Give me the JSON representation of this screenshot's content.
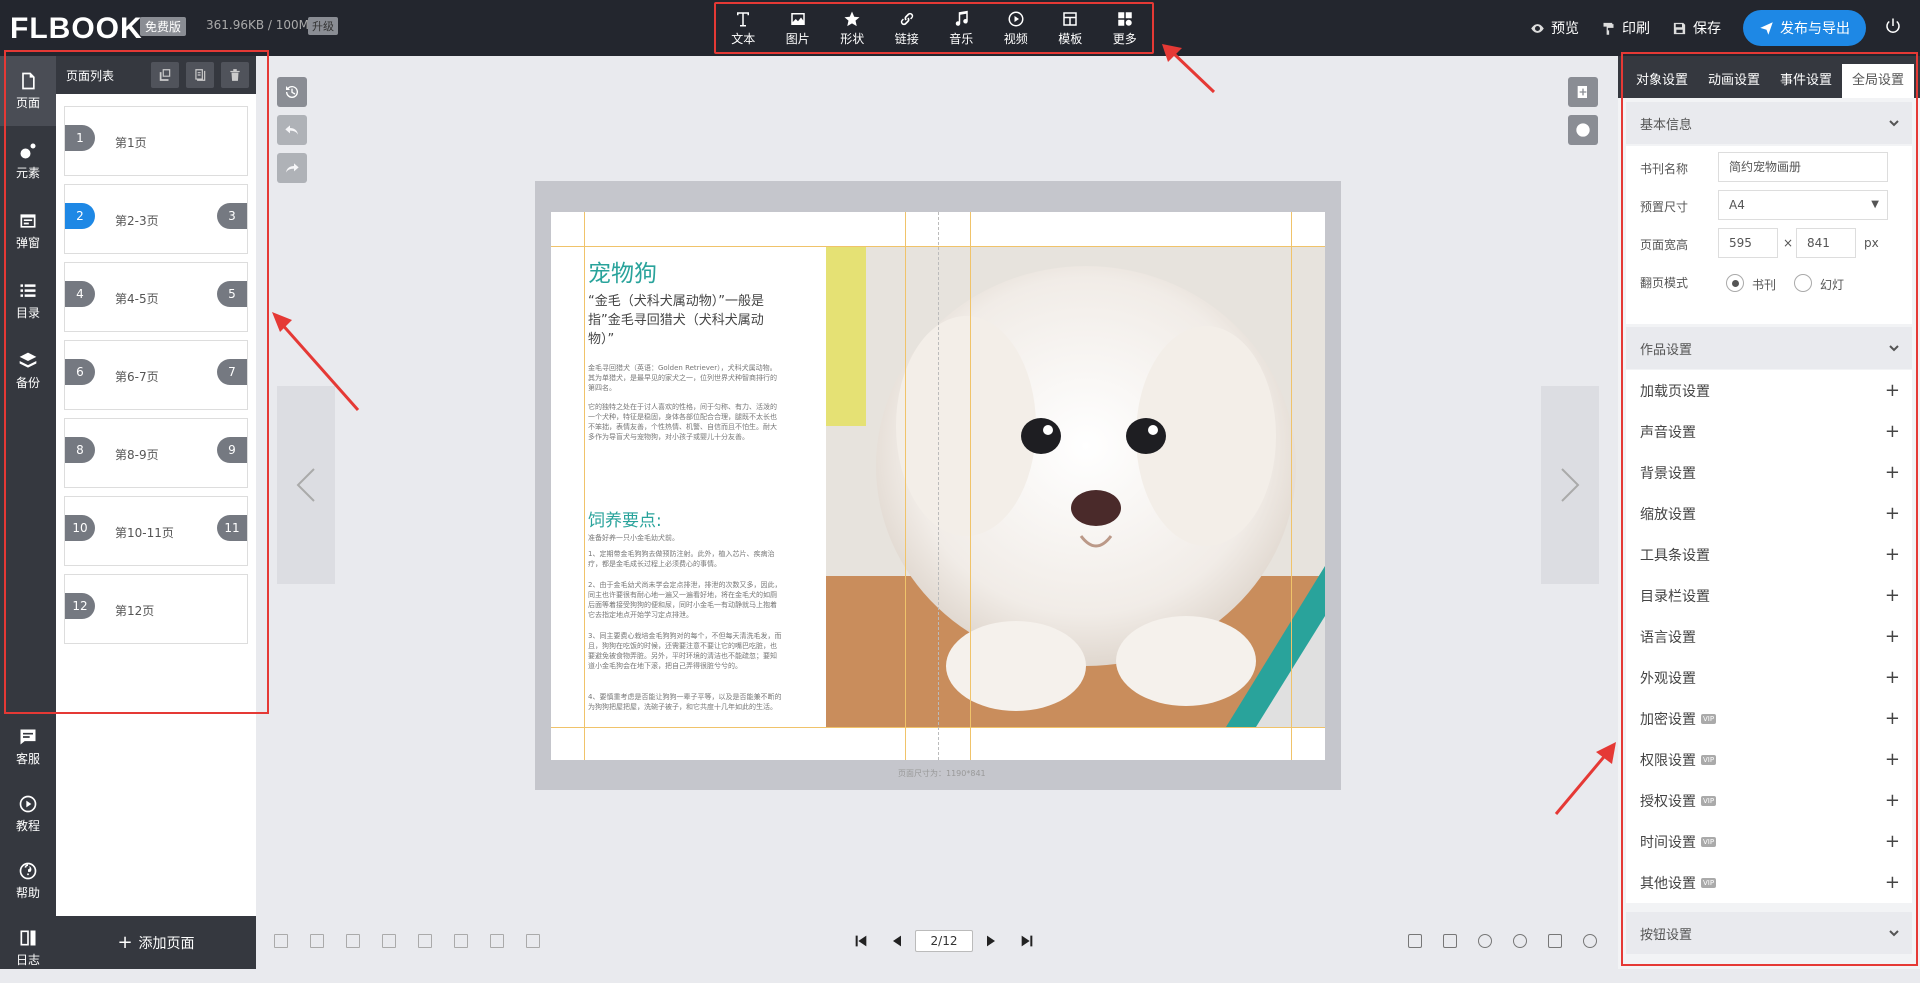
{
  "app": {
    "logo": "FLBOOK",
    "logo_mark": "®",
    "free_badge": "免费版",
    "storage": "361.96KB / 100M",
    "upgrade_badge": "升级"
  },
  "toolbar": {
    "items": [
      {
        "label": "文本",
        "icon": "text-icon"
      },
      {
        "label": "图片",
        "icon": "image-icon"
      },
      {
        "label": "形状",
        "icon": "star-icon"
      },
      {
        "label": "链接",
        "icon": "link-icon"
      },
      {
        "label": "音乐",
        "icon": "music-icon"
      },
      {
        "label": "视频",
        "icon": "video-icon"
      },
      {
        "label": "模板",
        "icon": "template-icon"
      },
      {
        "label": "更多",
        "icon": "more-icon"
      }
    ]
  },
  "topright": {
    "preview": "预览",
    "print": "印刷",
    "save": "保存",
    "publish": "发布与导出"
  },
  "leftnav": {
    "items": [
      "页面",
      "元素",
      "弹窗",
      "目录",
      "备份",
      "客服",
      "教程",
      "帮助",
      "日志"
    ]
  },
  "pagepanel": {
    "title": "页面列表",
    "pages": [
      {
        "label": "第1页",
        "left": "1",
        "right": ""
      },
      {
        "label": "第2-3页",
        "left": "2",
        "right": "3"
      },
      {
        "label": "第4-5页",
        "left": "4",
        "right": "5"
      },
      {
        "label": "第6-7页",
        "left": "6",
        "right": "7"
      },
      {
        "label": "第8-9页",
        "left": "8",
        "right": "9"
      },
      {
        "label": "第10-11页",
        "left": "10",
        "right": "11"
      },
      {
        "label": "第12页",
        "left": "12",
        "right": ""
      }
    ],
    "add_page": "添加页面"
  },
  "book": {
    "title": "宠物狗",
    "subtitle": "“金毛（犬科犬属动物）”一般是指”金毛寻回猎犬（犬科犬属动物）”",
    "para1": "金毛寻回猎犬（英语：Golden Retriever），犬科犬属动物。其为单猎犬，是最早见的家犬之一，位列世界犬种智商排行的第四名。",
    "para2": "它的独特之处在于讨人喜欢的性格，间于匀称、有力、活泼的一个犬种，特征是稳固，身体各部位配合合理，腿既不太长也不笨拙，表情友善，个性热情、机警、自信而且不怕生。耐大多作为导盲犬与宠物狗，对小孩子或婴儿十分友善。",
    "h2": "饲养要点:",
    "para3": "准备好养一只小金毛幼犬前。",
    "para4": "1、定期带金毛狗狗去做预防注射。此外，植入芯片、疾病治疗，都是金毛成长过程上必须费心的事情。",
    "para5": "2、由于金毛幼犬尚未学会定点排泄，排泄的次数又多，因此，同主也许要很有耐心地一遍又一遍看好地，将在金毛犬的如厕后面等着接受狗狗的便和尿，同时小金毛一有动静就马上抱着它去指定地点开始学习定点排泄。",
    "para6": "3、同主要费心栽培金毛狗狗对的每个，不但每天清洗毛发，而且，狗狗在吃饭的时候，还需要注意不要让它的嘴巴吃脏，也要避免被食物弄脏。另外，平时环境的清洁也不能疏忽；要知道小金毛狗会在地下滚，把自己弄得很脏兮兮的。",
    "para7": "4、要慎重考虑是否能让狗狗一辈子平等，以及是否能兼不断的为狗狗把屋把屋，洗碗子被子，和它共度十几年如此的生活。",
    "size_caption": "页面尺寸为：1190*841"
  },
  "bottombar": {
    "page_value": "2/12"
  },
  "rightpanel": {
    "tabs": [
      "对象设置",
      "动画设置",
      "事件设置",
      "全局设置"
    ],
    "basic_title": "基本信息",
    "fields": {
      "book_name_label": "书刊名称",
      "book_name_value": "简约宠物画册",
      "preset_label": "预置尺寸",
      "preset_value": "A4",
      "size_label": "页面宽高",
      "width": "595",
      "times": "×",
      "height": "841",
      "unit": "px",
      "flip_label": "翻页模式",
      "mode_book": "书刊",
      "mode_slide": "幻灯"
    },
    "works_title": "作品设置",
    "settings": [
      {
        "label": "加载页设置",
        "vip": ""
      },
      {
        "label": "声音设置",
        "vip": ""
      },
      {
        "label": "背景设置",
        "vip": ""
      },
      {
        "label": "缩放设置",
        "vip": ""
      },
      {
        "label": "工具条设置",
        "vip": ""
      },
      {
        "label": "目录栏设置",
        "vip": ""
      },
      {
        "label": "语言设置",
        "vip": ""
      },
      {
        "label": "外观设置",
        "vip": ""
      },
      {
        "label": "加密设置",
        "vip": "VIP"
      },
      {
        "label": "权限设置",
        "vip": "VIP"
      },
      {
        "label": "授权设置",
        "vip": "VIP"
      },
      {
        "label": "时间设置",
        "vip": "VIP"
      },
      {
        "label": "其他设置",
        "vip": "VIP"
      }
    ],
    "button_title": "按钮设置"
  },
  "colors": {
    "accent": "#1e88e5",
    "teal": "#29a39b",
    "annotation": "#e53935",
    "topbar": "#23262e"
  }
}
